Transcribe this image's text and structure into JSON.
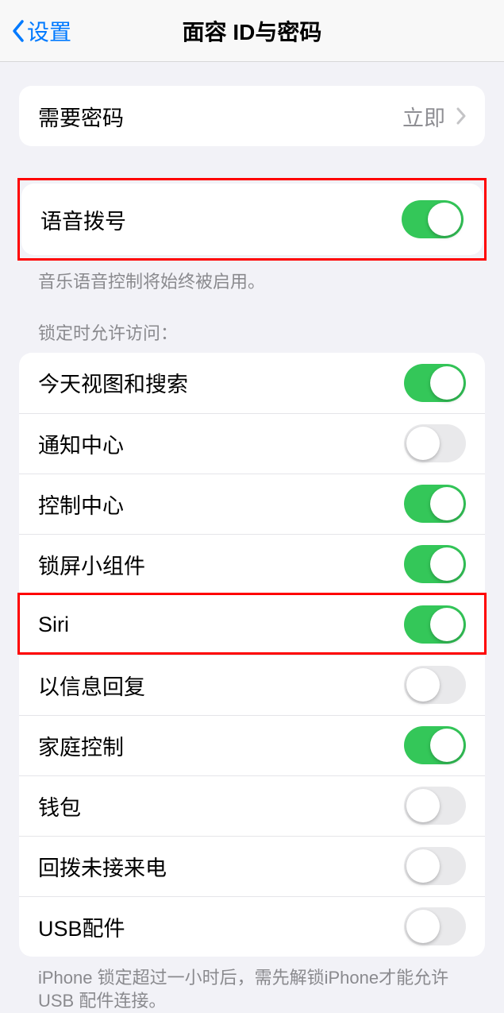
{
  "nav": {
    "back_label": "设置",
    "title": "面容 ID与密码"
  },
  "require_passcode": {
    "label": "需要密码",
    "value": "立即"
  },
  "voice_dial": {
    "label": "语音拨号",
    "on": true,
    "footer": "音乐语音控制将始终被启用。"
  },
  "locked_access": {
    "header": "锁定时允许访问：",
    "items": [
      {
        "label": "今天视图和搜索",
        "on": true
      },
      {
        "label": "通知中心",
        "on": false
      },
      {
        "label": "控制中心",
        "on": true
      },
      {
        "label": "锁屏小组件",
        "on": true
      },
      {
        "label": "Siri",
        "on": true
      },
      {
        "label": "以信息回复",
        "on": false
      },
      {
        "label": "家庭控制",
        "on": true
      },
      {
        "label": "钱包",
        "on": false
      },
      {
        "label": "回拨未接来电",
        "on": false
      },
      {
        "label": "USB配件",
        "on": false
      }
    ],
    "footer": "iPhone 锁定超过一小时后，需先解锁iPhone才能允许USB 配件连接。"
  },
  "highlights": {
    "voice_dial": true,
    "siri_index": 4
  }
}
